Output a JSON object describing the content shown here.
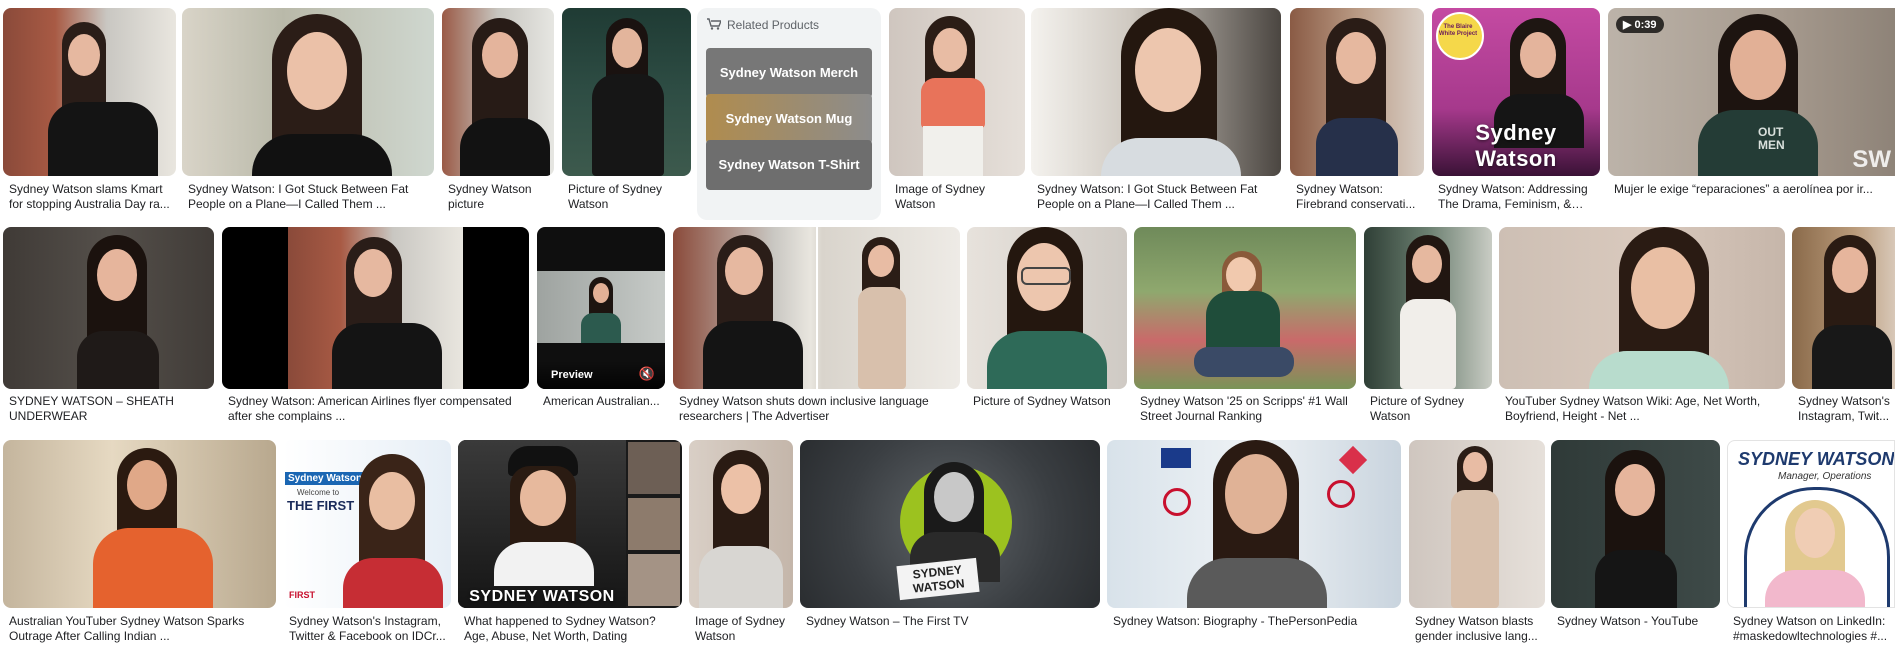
{
  "related_products": {
    "heading": "Related Products",
    "items": [
      {
        "label": "Sydney Watson Merch"
      },
      {
        "label": "Sydney Watson Mug"
      },
      {
        "label": "Sydney Watson T-Shirt"
      }
    ]
  },
  "row1": [
    {
      "caption": "Sydney Watson slams Kmart for stopping Australia Day ra..."
    },
    {
      "caption": "Sydney Watson: I Got Stuck Between Fat People on a Plane—I Called Them ..."
    },
    {
      "caption": "Sydney Watson picture"
    },
    {
      "caption": "Picture of Sydney Watson"
    },
    {
      "caption": "Image of Sydney Watson"
    },
    {
      "caption": "Sydney Watson: I Got Stuck Between Fat People on a Plane—I Called Them ..."
    },
    {
      "caption": "Sydney Watson: Firebrand conservati..."
    },
    {
      "caption": "Sydney Watson: Addressing The Drama, Feminism, & To...",
      "overlay": "Sydney Watson",
      "badge": "The Blaire White Project"
    },
    {
      "caption": "Mujer le exige “reparaciones” a aerolínea por ir...",
      "duration": "0:39",
      "watermark": "SW",
      "shirt_text": "OUT MEN"
    }
  ],
  "row2": [
    {
      "caption": "SYDNEY WATSON – SHEATH UNDERWEAR"
    },
    {
      "caption": "Sydney Watson: American Airlines flyer compensated after she complains ..."
    },
    {
      "caption": "American Australian...",
      "preview_label": "Preview",
      "mute": "🔇"
    },
    {
      "caption": "Sydney Watson shuts down inclusive language researchers | The Advertiser"
    },
    {
      "caption": "Picture of Sydney Watson"
    },
    {
      "caption": "Sydney Watson '25 on Scripps' #1 Wall Street Journal Ranking"
    },
    {
      "caption": "Picture of Sydney Watson"
    },
    {
      "caption": "YouTuber Sydney Watson Wiki: Age, Net Worth, Boyfriend, Height - Net ..."
    },
    {
      "caption": "Sydney Watson's Instagram, Twit..."
    }
  ],
  "row3": [
    {
      "caption": "Australian YouTuber Sydney Watson Sparks Outrage After Calling Indian ..."
    },
    {
      "caption": "Sydney Watson's Instagram, Twitter & Facebook on IDCr...",
      "tag": "Sydney Watson",
      "sub": "Welcome to",
      "logo": "THE FIRST",
      "logo2": "FIRST"
    },
    {
      "caption": "What happened to Sydney Watson? Age, Abuse, Net Worth, Dating",
      "overlay": "SYDNEY WATSON"
    },
    {
      "caption": "Image of Sydney Watson"
    },
    {
      "caption": "Sydney Watson – The First TV",
      "overlay": "SYDNEY WATSON"
    },
    {
      "caption": "Sydney Watson: Biography - ThePersonPedia"
    },
    {
      "caption": "Sydney Watson blasts gender inclusive lang..."
    },
    {
      "caption": "Sydney Watson - YouTube"
    },
    {
      "caption": "Sydney Watson on LinkedIn: #maskedowltechnologies #...",
      "name": "SYDNEY WATSON",
      "role": "Manager, Operations"
    }
  ]
}
